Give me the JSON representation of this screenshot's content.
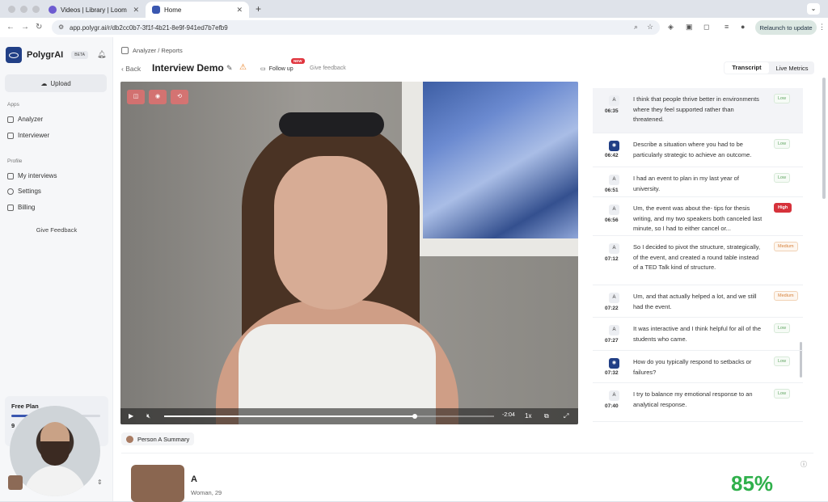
{
  "browser": {
    "tabs": [
      {
        "label": "Videos | Library | Loom"
      },
      {
        "label": "Home"
      }
    ],
    "url": "app.polygr.ai/r/db2cc0b7-3f1f-4b21-8e9f-941ed7b7efb9",
    "relaunch": "Relaunch to update"
  },
  "sidebar": {
    "brand": "PolygrAI",
    "beta": "BETA",
    "upload": "Upload",
    "apps_label": "Apps",
    "apps": [
      {
        "label": "Analyzer"
      },
      {
        "label": "Interviewer"
      }
    ],
    "profile_label": "Profile",
    "profile": [
      {
        "label": "My interviews"
      },
      {
        "label": "Settings"
      },
      {
        "label": "Billing"
      }
    ],
    "give_feedback": "Give Feedback",
    "plan": "Free Plan",
    "plan_count": "9"
  },
  "header": {
    "breadcrumb": "Analyzer / Reports",
    "back": "Back",
    "title": "Interview Demo",
    "follow_up": "Follow up",
    "new_badge": "NEW",
    "give_feedback": "Give feedback",
    "tabs": [
      {
        "label": "Transcript"
      },
      {
        "label": "Live Metrics"
      }
    ]
  },
  "video": {
    "time": "-2:04",
    "speed": "1x",
    "progress": 0.76
  },
  "transcript": [
    {
      "speaker": "A",
      "time": "06:35",
      "text": "I think that people thrive better in environments where they feel supported rather than threatened.",
      "level": "Low"
    },
    {
      "speaker": "AI",
      "time": "06:42",
      "text": "Describe a situation where you had to be particularly strategic to achieve an outcome.",
      "level": "Low"
    },
    {
      "speaker": "A",
      "time": "06:51",
      "text": "I had an event to plan in my last year of university.",
      "level": "Low"
    },
    {
      "speaker": "A",
      "time": "06:56",
      "text": "Um, the event was about the- tips for thesis writing, and my two speakers both canceled last minute, so I had to either cancel or...",
      "level": "High"
    },
    {
      "speaker": "A",
      "time": "07:12",
      "text": "So I decided to pivot the structure, strategically, of the event, and created a round table instead of a TED Talk kind of structure.",
      "level": "Medium"
    },
    {
      "speaker": "A",
      "time": "07:22",
      "text": "Um, and that actually helped a lot, and we still had the event.",
      "level": "Medium"
    },
    {
      "speaker": "A",
      "time": "07:27",
      "text": "It was interactive and I think helpful for all of the students who came.",
      "level": "Low"
    },
    {
      "speaker": "AI",
      "time": "07:32",
      "text": "How do you typically respond to setbacks or failures?",
      "level": "Low"
    },
    {
      "speaker": "A",
      "time": "07:40",
      "text": "I try to balance my emotional response to an analytical response.",
      "level": "Low"
    }
  ],
  "summary": {
    "tag": "Person A Summary",
    "name": "A",
    "sub": "Woman, 29",
    "score": "85%"
  },
  "colors": {
    "accent": "#213f86",
    "score": "#2fb04b",
    "high": "#d6323b",
    "medium": "#d7823c",
    "low": "#5ea35f"
  }
}
